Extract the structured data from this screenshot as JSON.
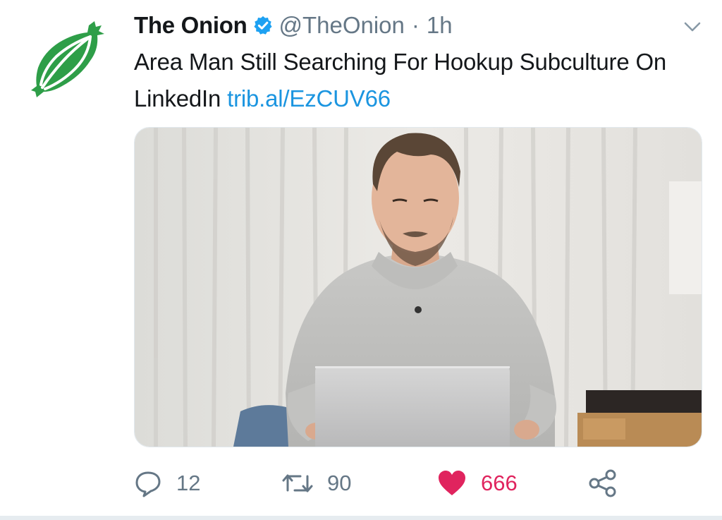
{
  "tweet": {
    "author_name": "The Onion",
    "handle": "@TheOnion",
    "separator": "·",
    "time": "1h",
    "text": "Area Man Still Searching For Hookup Subculture On LinkedIn",
    "link": "trib.al/EzCUV66"
  },
  "icons": {
    "avatar": "onion-logo",
    "verified": "verified-badge-icon",
    "menu": "chevron-down-icon",
    "reply": "reply-icon",
    "retweet": "retweet-icon",
    "like": "heart-icon",
    "share": "share-icon"
  },
  "actions": {
    "reply_count": "12",
    "retweet_count": "90",
    "like_count": "666"
  },
  "colors": {
    "link": "#1b95e0",
    "verified": "#1da1f2",
    "like": "#e0245e",
    "muted": "#657786",
    "onion_green": "#2e9e48"
  }
}
